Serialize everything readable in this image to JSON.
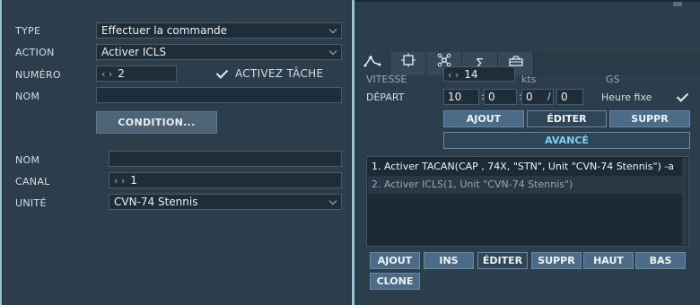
{
  "left": {
    "type": {
      "label": "TYPE",
      "value": "Effectuer la commande"
    },
    "action": {
      "label": "ACTION",
      "value": "Activer ICLS"
    },
    "numero": {
      "label": "NUMÉRO",
      "arrows": "‹ ›",
      "value": "2"
    },
    "activez": {
      "label": "ACTIVEZ TÂCHE",
      "checked": true
    },
    "nom1": {
      "label": "NOM",
      "value": ""
    },
    "condition_button": "CONDITION...",
    "nom2": {
      "label": "NOM",
      "value": ""
    },
    "canal": {
      "label": "CANAL",
      "arrows": "‹ ›",
      "value": "1"
    },
    "unite": {
      "label": "UNITÉ",
      "value": "CVN-74 Stennis"
    }
  },
  "right": {
    "vitesse": {
      "label": "VITESSE",
      "arrows": "‹ ›",
      "value": "14",
      "unit": "kts",
      "gs": "GS"
    },
    "depart": {
      "label": "DÉPART",
      "h": "10",
      "m": "0",
      "s": "0",
      "sep": "/",
      "d": "0",
      "heure_fixe": "Heure fixe",
      "checked": true
    },
    "buttons_top": {
      "ajout": "AJOUT",
      "editer": "ÉDITER",
      "suppr": "SUPPR"
    },
    "avance": "AVANCÉ",
    "actions_list": [
      "1. Activer TACAN(CAP , 74X, \"STN\", Unit \"CVN-74 Stennis\")   -a",
      "2. Activer ICLS(1, Unit \"CVN-74 Stennis\")"
    ],
    "buttons_bottom": {
      "ajout": "AJOUT",
      "ins": "INS",
      "editer": "ÉDITER",
      "suppr": "SUPPR",
      "haut": "HAUT",
      "bas": "BAS",
      "clone": "CLONE"
    },
    "tabs": [
      "waypoint-icon",
      "target-icon",
      "network-icon",
      "sigma-icon",
      "tank-icon"
    ]
  }
}
